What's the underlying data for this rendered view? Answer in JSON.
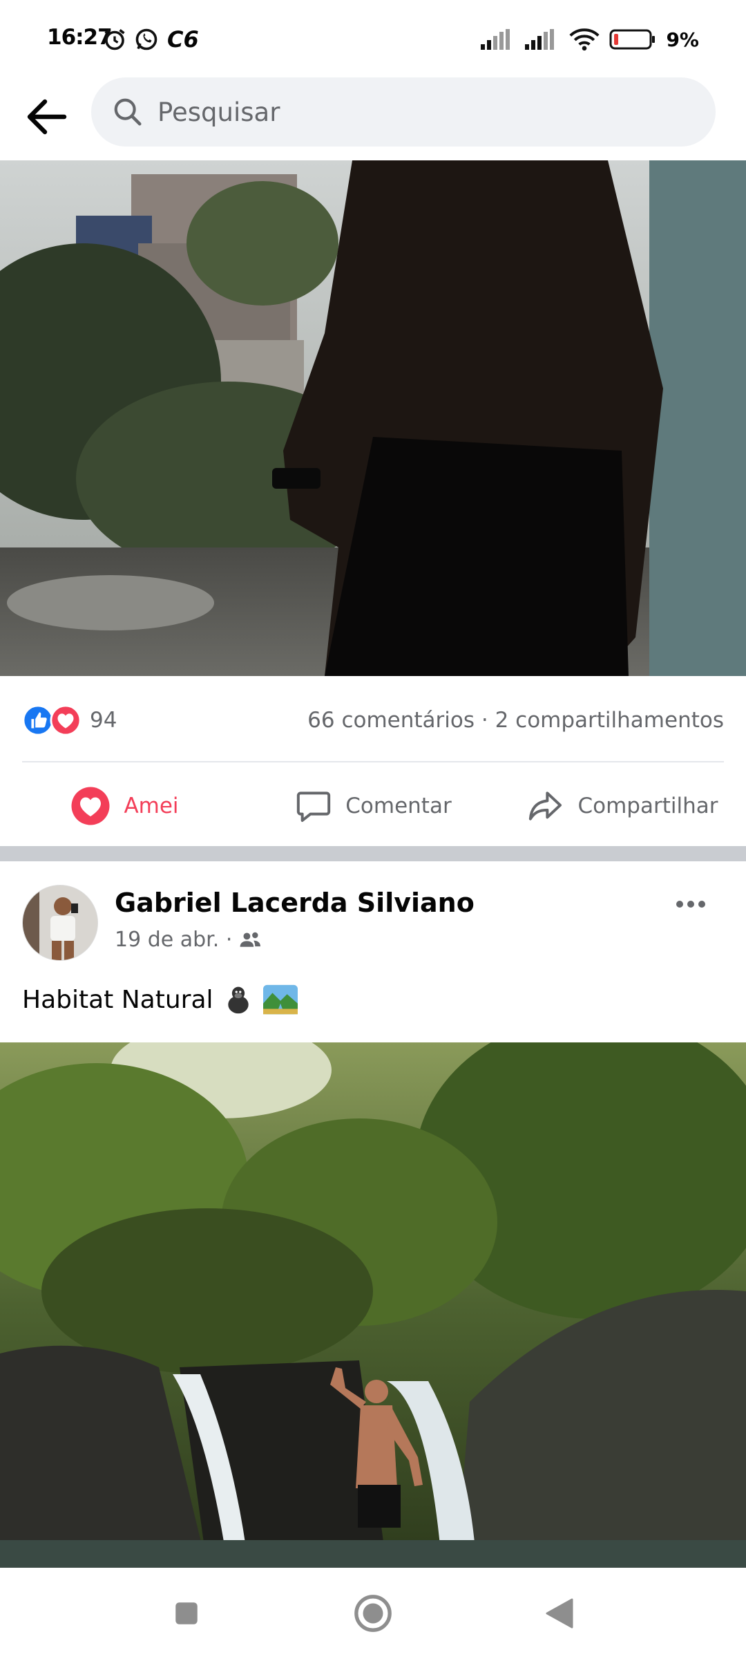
{
  "status_bar": {
    "time": "16:27",
    "carrier_badge": "C6",
    "battery": "9%"
  },
  "search": {
    "placeholder": "Pesquisar"
  },
  "post1": {
    "reaction_count": "94",
    "stats": "66 comentários · 2 compartilhamentos",
    "actions": {
      "love_label": "Amei",
      "comment_label": "Comentar",
      "share_label": "Compartilhar"
    }
  },
  "post2": {
    "author": "Gabriel Lacerda Silviano",
    "date": "19 de abr. ·",
    "text": "Habitat Natural"
  },
  "colors": {
    "love": "#f33e58",
    "like": "#1877f2",
    "secondary_text": "#65676b",
    "separator": "#c9ccd1"
  }
}
